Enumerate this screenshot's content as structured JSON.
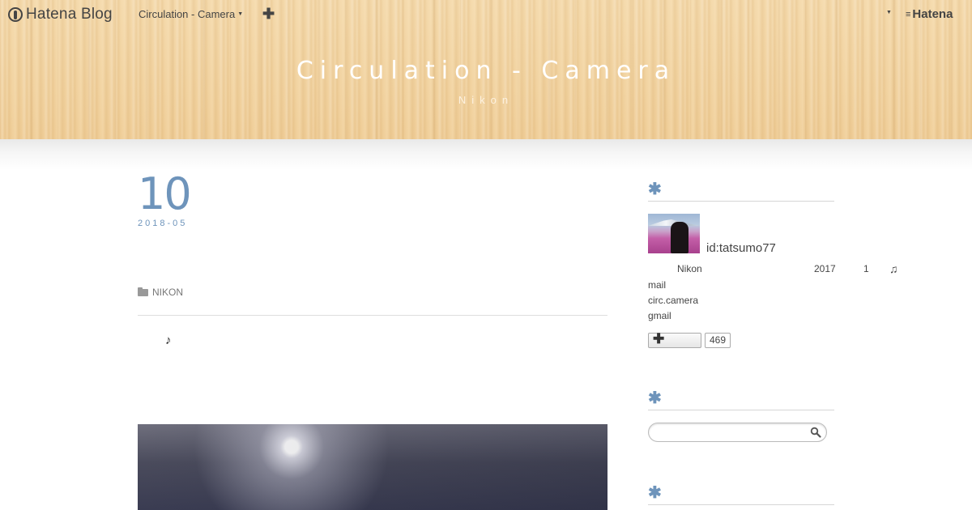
{
  "globalbar": {
    "logo_text": "Hatena Blog",
    "blog_menu": "Circulation - Camera",
    "add_symbol": "✚",
    "hatena_text": "Hatena"
  },
  "blog": {
    "title": "Circulation - Camera",
    "description": "Nikon"
  },
  "entry": {
    "date_day": "10",
    "date_ym": "2018-05",
    "category": "NIKON",
    "note": "♪"
  },
  "sidebar": {
    "module_symbol": "✱",
    "profile": {
      "id": "id:tatsumo77",
      "about": {
        "camera": "Nikon",
        "year": "2017",
        "month": "1",
        "note": "♫",
        "mail_label": "mail",
        "mail_user": "circ.camera",
        "mail_domain": "gmail"
      },
      "star_symbol": "✚",
      "star_count": "469"
    },
    "search": {
      "placeholder": ""
    }
  },
  "colors": {
    "accent": "#6e94bb",
    "header_wood": "#f1d2a0"
  },
  "icons": [
    "hatena-blog-logo-icon",
    "caret-down-icon",
    "plus-icon",
    "hatena-logo-icon",
    "folder-icon",
    "search-icon"
  ]
}
